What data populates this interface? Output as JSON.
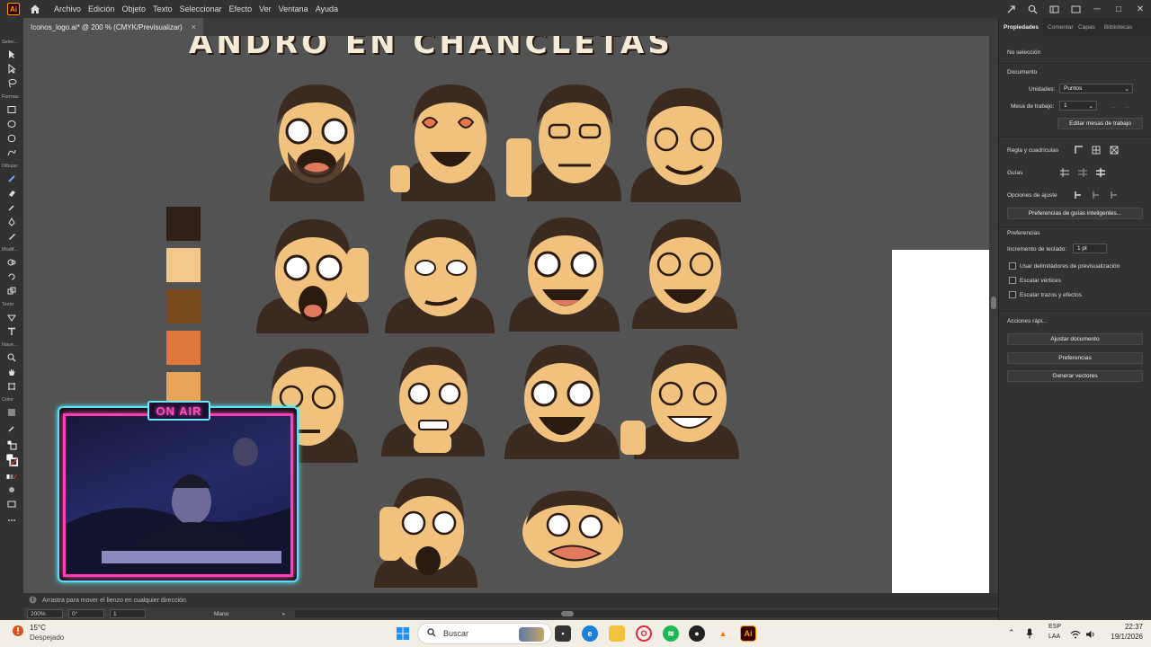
{
  "app": {
    "logo": "Ai"
  },
  "menu": [
    "Archivo",
    "Edición",
    "Objeto",
    "Texto",
    "Seleccionar",
    "Efecto",
    "Ver",
    "Ventana",
    "Ayuda"
  ],
  "document_tab": {
    "title": "Iconos_logo.ai* @ 200 % (CMYK/Previsualizar)",
    "close": "×"
  },
  "banner_text": "ANDRO EN CHANCLETAS",
  "tool_groups": [
    "Selec...",
    "Formas",
    "Dibujar",
    "Modif...",
    "Texto",
    "Nave...",
    "Color"
  ],
  "swatches": [
    "#2f2118",
    "#f2c98a",
    "#7a4a1c",
    "#e0793b",
    "#e8a55a"
  ],
  "webcam": {
    "badge": "ON AIR"
  },
  "statusbar": {
    "hint": "Arrastra para mover el lienzo en cualquier dirección."
  },
  "bottombar": {
    "zoom": "200%",
    "rotation": "0°",
    "artboard": "1",
    "tool": "Mano"
  },
  "panel": {
    "tabs": [
      "Propiedades",
      "Comentarios",
      "Capas",
      "Bibliotecas"
    ],
    "no_selection": "No selección",
    "document_heading": "Documento",
    "units_label": "Unidades:",
    "units_value": "Puntos",
    "artboard_label": "Mesa de trabajo:",
    "artboard_value": "1",
    "edit_artboards": "Editar mesas de trabajo",
    "rulers_label": "Regla y cuadrículas",
    "guides_label": "Guías",
    "snap_label": "Opciones de ajuste",
    "smart_guides_btn": "Preferencias de guías inteligentes...",
    "prefs_heading": "Preferencias",
    "keyboard_inc_label": "Incremento de teclado:",
    "keyboard_inc_value": "1 pt",
    "checkboxes": [
      "Usar delimitadores de previsualización",
      "Escalar vértices",
      "Escalar trazos y efectos"
    ],
    "quick_actions_heading": "Acciones rápi...",
    "quick_buttons": [
      "Ajustar documento",
      "Preferencias",
      "Generar vectores"
    ]
  },
  "taskbar": {
    "weather_temp": "15°C",
    "weather_desc": "Despejado",
    "search_placeholder": "Buscar",
    "lang_top": "ESP",
    "lang_bottom": "LAA",
    "time": "22:37",
    "date": "19/1/2026"
  }
}
